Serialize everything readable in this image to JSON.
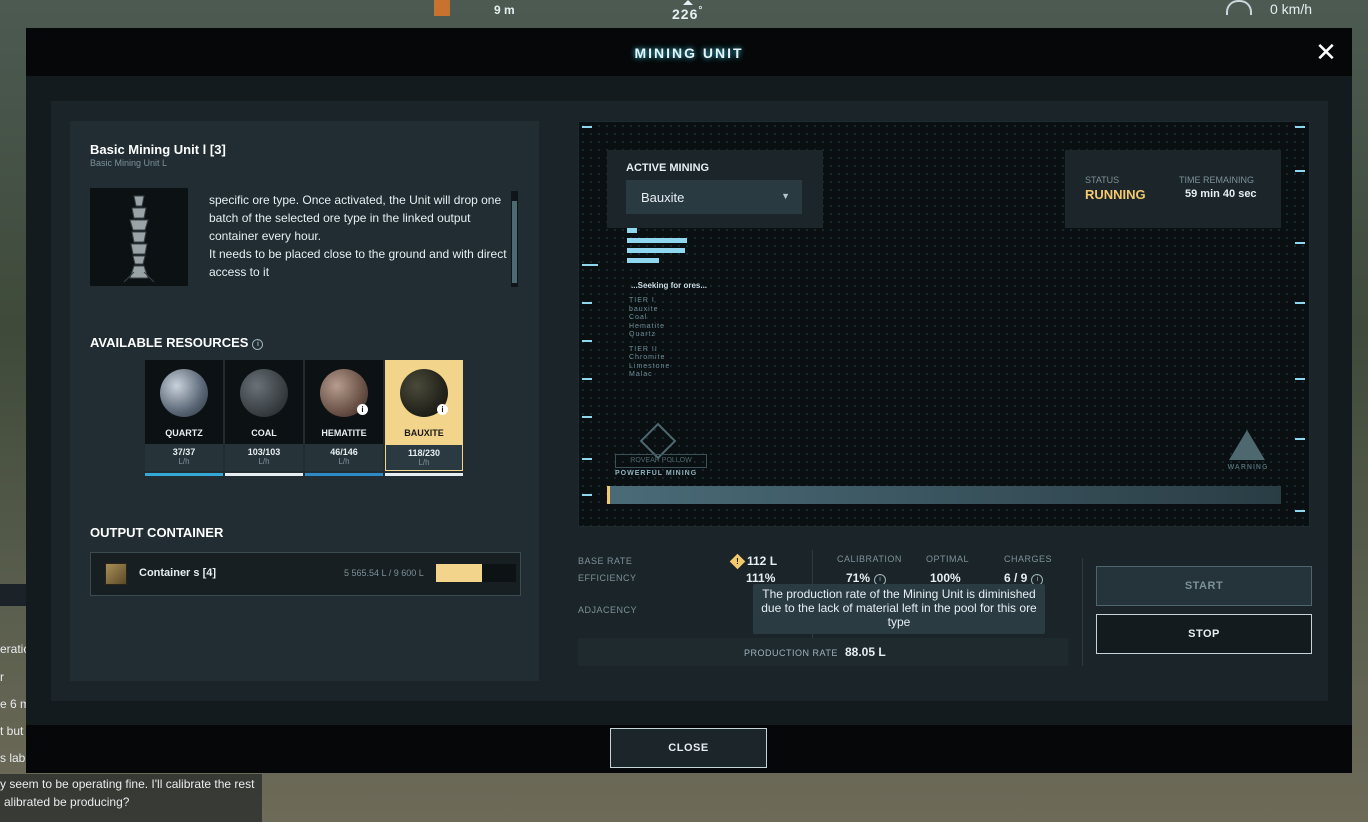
{
  "hud": {
    "altitude": "9 m",
    "heading": "226",
    "degree_symbol": "°",
    "speed": "0 km/h"
  },
  "chat": {
    "lines": [
      "eratio",
      "r",
      "e 6 m",
      "t but",
      "s lab",
      "y seem to be operating fine. I'll calibrate the rest",
      "alibrated be producing?"
    ]
  },
  "modal": {
    "title": "MINING UNIT",
    "close_icon": "close-icon"
  },
  "unit": {
    "name": "Basic Mining Unit l [3]",
    "subtitle": "Basic Mining Unit L",
    "description_partial": "specific ore type. Once activated, the Unit will drop one batch of the selected ore type in the linked output container every hour.",
    "description_2": "It needs to be placed close to the ground and with direct access to it"
  },
  "resources": {
    "title": "AVAILABLE RESOURCES",
    "unit_label": "L/h",
    "items": [
      {
        "name": "QUARTZ",
        "count": "37/37",
        "color": "#35a9d6"
      },
      {
        "name": "COAL",
        "count": "103/103",
        "color": "#e6eef2"
      },
      {
        "name": "HEMATITE",
        "count": "46/146",
        "color": "#2c8ac7"
      },
      {
        "name": "BAUXITE",
        "count": "118/230",
        "color": "#e6eef2"
      }
    ],
    "info": "i"
  },
  "output": {
    "title": "OUTPUT CONTAINER",
    "name": "Container s [4]",
    "volume": "5 565.54 L / 9 600 L",
    "fill": 0.58
  },
  "screen": {
    "active_title": "ACTIVE MINING",
    "selected_ore": "Bauxite",
    "arrow": "▼",
    "status_label": "STATUS",
    "status_value": "RUNNING",
    "time_label": "TIME REMAINING",
    "time_value": "59 min 40 sec",
    "seeking": "...Seeking for ores...",
    "tiers": [
      "TIER I",
      "bauxite",
      "Coal",
      "Hematite",
      "Quartz",
      "",
      "TIER II",
      "Chromite",
      "Limestone",
      "Malac"
    ],
    "logo_text": "ROVEAR POLLOW",
    "logo_caption": "POWERFUL MINING",
    "warning": "WARNING"
  },
  "stats": {
    "base_rate_label": "BASE RATE",
    "base_rate_value": "112 L",
    "efficiency_label": "EFFICIENCY",
    "efficiency_value": "111%",
    "adjacency_label": "ADJACENCY",
    "calibration_label": "CALIBRATION",
    "calibration_value": "71%",
    "optimal_label": "OPTIMAL",
    "optimal_value": "100%",
    "charges_label": "CHARGES",
    "charges_value": "6 / 9",
    "tooltip": "The production rate of the Mining Unit is diminished due to the lack of material left in the pool for this ore type",
    "production_label": "PRODUCTION RATE",
    "production_value": "88.05 L",
    "warn": "!"
  },
  "buttons": {
    "start": "START",
    "stop": "STOP",
    "close": "CLOSE"
  }
}
